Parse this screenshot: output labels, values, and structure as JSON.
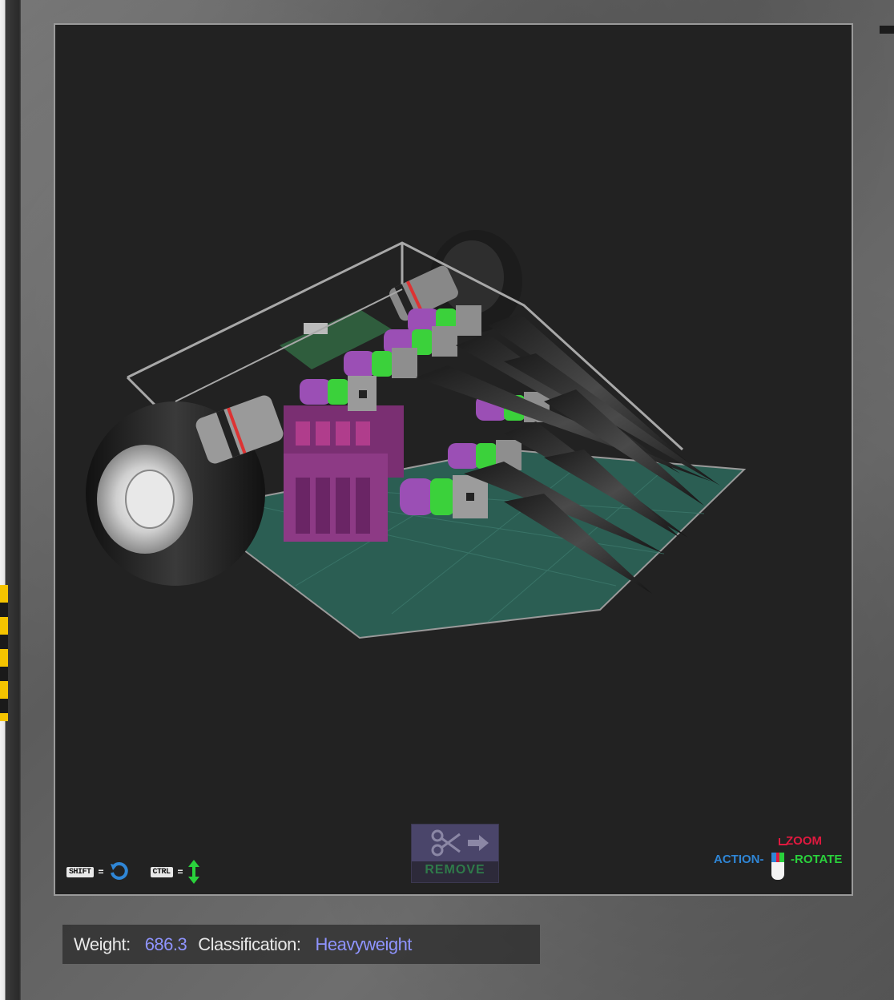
{
  "viewport": {
    "hints": {
      "shift_key": "SHIFT",
      "ctrl_key": "CTRL",
      "equals": "="
    },
    "remove_button": {
      "label": "REMOVE"
    },
    "mouse_legend": {
      "zoom": "ZOOM",
      "action": "ACTION",
      "rotate": "ROTATE"
    }
  },
  "status": {
    "weight_label": "Weight:",
    "weight_value": "686.3",
    "classification_label": "Classification:",
    "classification_value": "Heavyweight"
  },
  "colors": {
    "zoom": "#e0193f",
    "action": "#2f86d6",
    "rotate": "#2ad13c",
    "value": "#8f94ff"
  }
}
